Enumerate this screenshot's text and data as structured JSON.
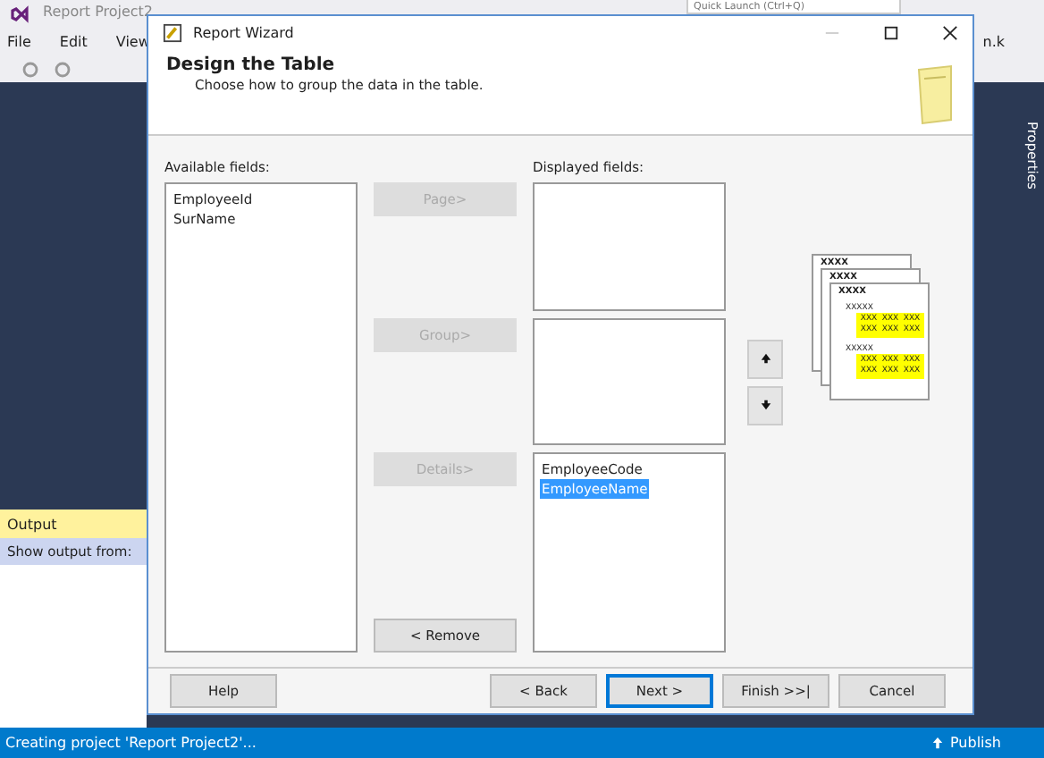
{
  "ide": {
    "title": "Report Project2",
    "quick_launch": {
      "placeholder": "Quick Launch (Ctrl+Q)"
    },
    "menu": [
      "File",
      "Edit",
      "View"
    ],
    "account": "n.k",
    "side_tab": "Properties",
    "output": {
      "title": "Output",
      "show_from": "Show output from:"
    },
    "status": "Creating project 'Report Project2'...",
    "publish": "Publish"
  },
  "dialog": {
    "title": "Report Wizard",
    "heading": "Design the Table",
    "subtitle": "Choose how to group the data in the table.",
    "available_label": "Available fields:",
    "available": [
      {
        "label": "EmployeeId",
        "selected": false
      },
      {
        "label": "SurName",
        "selected": false
      }
    ],
    "displayed_label": "Displayed fields:",
    "sections": [
      {
        "button": "Page>",
        "disabled": true
      },
      {
        "button": "Group>",
        "disabled": true
      },
      {
        "button": "Details>",
        "disabled": true,
        "fields": [
          {
            "label": "EmployeeCode",
            "selected": false
          },
          {
            "label": "EmployeeName",
            "selected": true
          }
        ]
      }
    ],
    "remove": {
      "label": "< Remove",
      "disabled": false
    },
    "preview": {
      "headers": [
        "XXXX",
        "XXXX",
        "XXXX"
      ],
      "groups": [
        {
          "label": "XXXXX",
          "cells": [
            "XXX",
            "XXX",
            "XXX",
            "XXX",
            "XXX",
            "XXX"
          ]
        },
        {
          "label": "XXXXX",
          "cells": [
            "XXX",
            "XXX",
            "XXX",
            "XXX",
            "XXX",
            "XXX"
          ]
        }
      ]
    },
    "footer": [
      {
        "label": "Help",
        "kind": "help",
        "default": false
      },
      {
        "label": "< Back",
        "kind": "nav",
        "default": false
      },
      {
        "label": "Next >",
        "kind": "nav",
        "default": true
      },
      {
        "label": "Finish >>|",
        "kind": "nav",
        "default": false
      },
      {
        "label": "Cancel",
        "kind": "nav",
        "default": false
      }
    ]
  }
}
